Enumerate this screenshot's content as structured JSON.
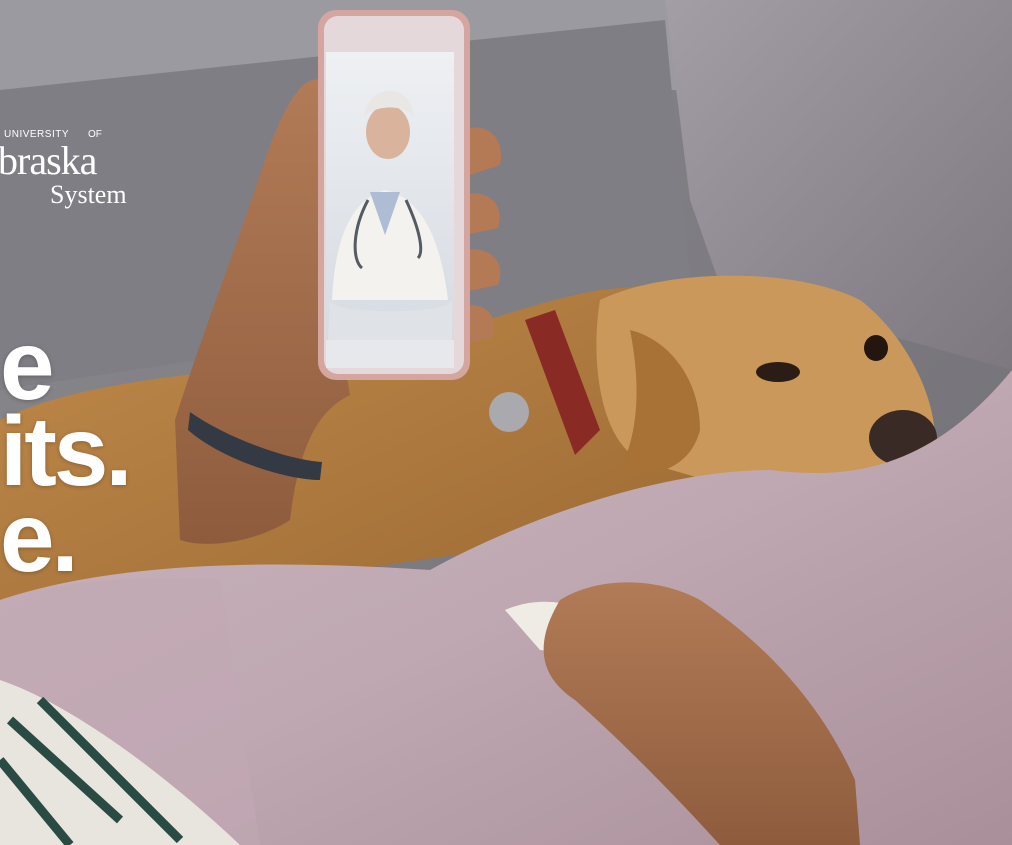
{
  "logo": {
    "top": "UNIVERSITY",
    "of": "OF",
    "main": "braska",
    "sub": "System"
  },
  "headline": {
    "line1": "e",
    "line2": "its.",
    "line3": "e."
  },
  "photo": {
    "description_icons": [
      "phone-icon",
      "doctor-icon",
      "dog-icon",
      "blanket-icon"
    ]
  }
}
